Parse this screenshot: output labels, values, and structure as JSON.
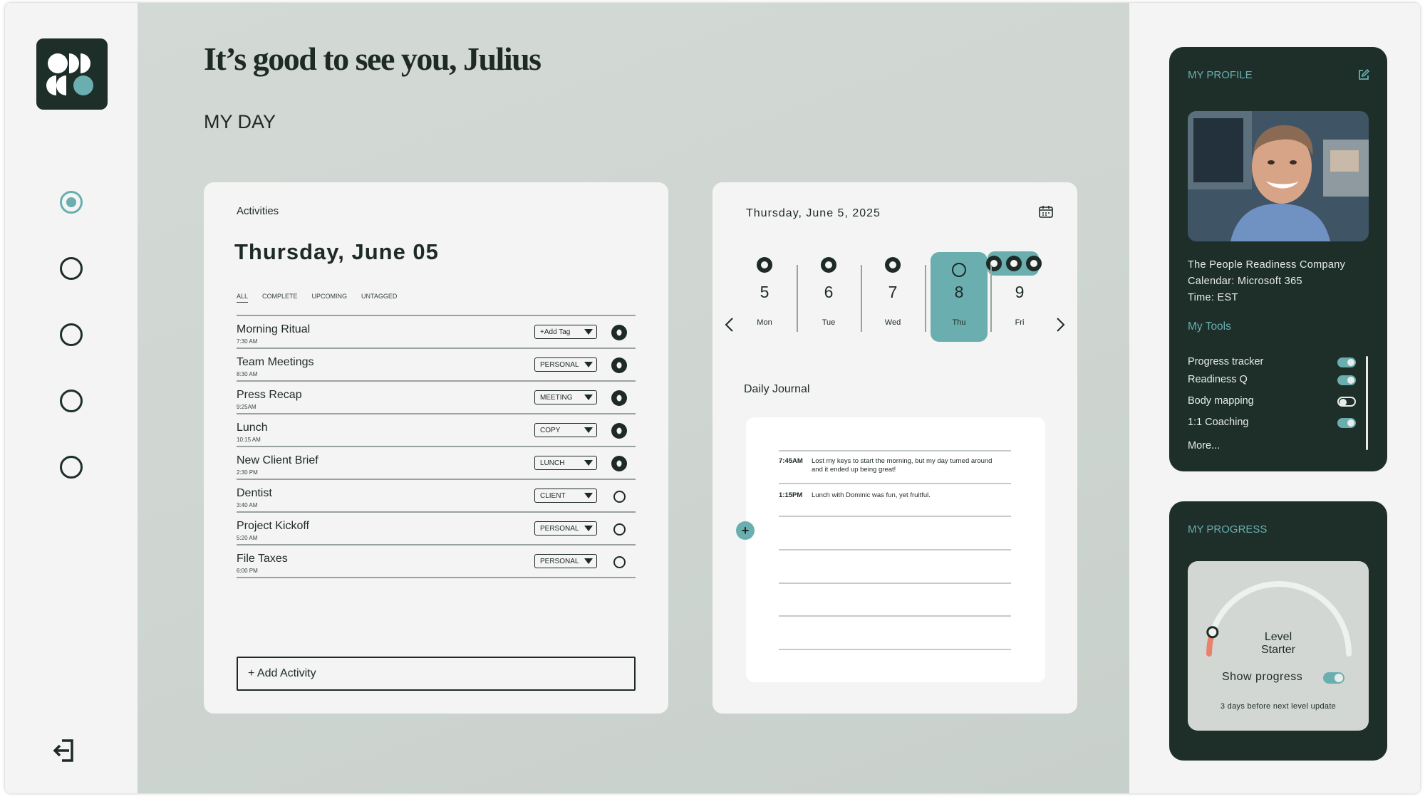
{
  "greeting": "It’s good to see you, Julius",
  "section_title": "MY DAY",
  "activities": {
    "label": "Activities",
    "date": "Thursday, June 05",
    "filters": [
      "ALL",
      "COMPLETE",
      "UPCOMING",
      "UNTAGGED"
    ],
    "active_filter": "ALL",
    "items": [
      {
        "name": "Morning Ritual",
        "time": "7:30 AM",
        "tag": "+Add Tag",
        "status": "complete"
      },
      {
        "name": "Team Meetings",
        "time": "8:30 AM",
        "tag": "PERSONAL",
        "status": "complete"
      },
      {
        "name": "Press Recap",
        "time": "9:25AM",
        "tag": "MEETING",
        "status": "complete"
      },
      {
        "name": "Lunch",
        "time": "10:15 AM",
        "tag": "COPY",
        "status": "complete"
      },
      {
        "name": "New Client Brief",
        "time": "2:30 PM",
        "tag": "LUNCH",
        "status": "complete"
      },
      {
        "name": "Dentist",
        "time": "3:40 AM",
        "tag": "CLIENT",
        "status": "incomplete"
      },
      {
        "name": "Project Kickoff",
        "time": "5:20 AM",
        "tag": "PERSONAL",
        "status": "incomplete"
      },
      {
        "name": "File Taxes",
        "time": "6:00 PM",
        "tag": "PERSONAL",
        "status": "incomplete"
      }
    ],
    "add_label": "+ Add Activity"
  },
  "calendar": {
    "date": "Thursday, June 5, 2025",
    "days": [
      {
        "num": "5",
        "dow": "Mon"
      },
      {
        "num": "6",
        "dow": "Tue"
      },
      {
        "num": "7",
        "dow": "Wed"
      },
      {
        "num": "8",
        "dow": "Thu"
      },
      {
        "num": "9",
        "dow": "Fri"
      }
    ],
    "selected_day": "8"
  },
  "journal": {
    "title": "Daily Journal",
    "entries": [
      {
        "time": "7:45AM",
        "text": "Lost my keys to start the morning, but my day turned around and it ended up being great!"
      },
      {
        "time": "1:15PM",
        "text": "Lunch with Dominic was fun, yet fruitful."
      }
    ],
    "add_symbol": "+"
  },
  "profile": {
    "title": "MY PROFILE",
    "company": "The People Readiness Company",
    "calendar": "Calendar: Microsoft 365",
    "time": "Time: EST",
    "tools_title": "My Tools",
    "tools": [
      {
        "label": "Progress tracker",
        "enabled": true
      },
      {
        "label": "Readiness Q",
        "enabled": true
      },
      {
        "label": "Body mapping",
        "enabled": false
      },
      {
        "label": "1:1 Coaching",
        "enabled": true
      }
    ],
    "more_label": "More..."
  },
  "progress": {
    "title": "MY PROGRESS",
    "level_label": "Level",
    "level_value": "Starter",
    "level_fraction": 0.1,
    "show_progress_label": "Show progress",
    "show_progress_enabled": true,
    "next_level_text": "3 days before next level update"
  },
  "colors": {
    "dark_green": "#1e2f29",
    "teal": "#6aaeb0",
    "progress_orange": "#e9826b"
  }
}
